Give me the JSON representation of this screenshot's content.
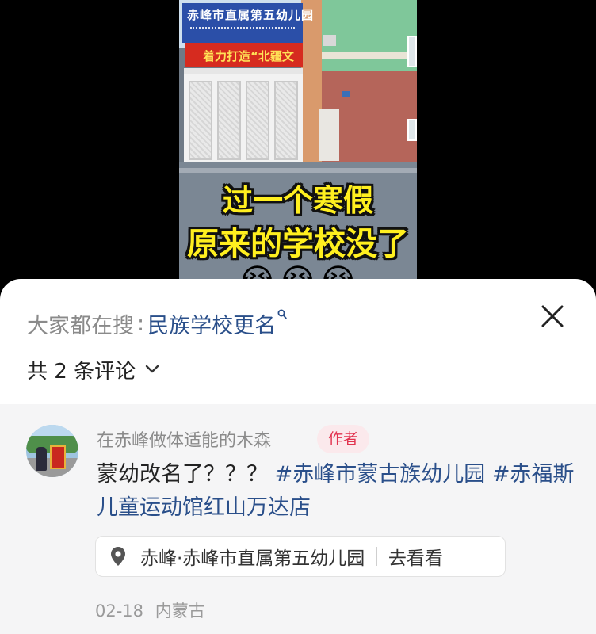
{
  "video": {
    "caption_line1": "过一个寒假",
    "caption_line2": "原来的学校没了",
    "caption_emoji": "😭😭😭",
    "sign_blue_text": "赤峰市直属第五幼儿园",
    "sign_red_text": "着力打造“北疆文"
  },
  "sheet": {
    "search": {
      "prefix": "大家都在搜",
      "separator": ":",
      "term": "民族学校更名",
      "icon": "search-icon"
    },
    "close_icon": "close-icon",
    "comment_count": "共 2 条评论",
    "count_icon": "chevron-down-icon"
  },
  "comment": {
    "username": "在赤峰做体适能的木森",
    "badge": "作者",
    "text": "蒙幼改名了？？？",
    "hashtag1": "#赤峰市蒙古族幼儿园",
    "hashtag2": "#赤福斯儿童运动馆红山万达店",
    "location": {
      "icon": "location-pin-icon",
      "name": "赤峰·赤峰市直属第五幼儿园",
      "action": "去看看"
    },
    "date": "02-18",
    "region": "内蒙古"
  },
  "colors": {
    "link": "#2a4f8a",
    "badge_bg": "#fbe9ec",
    "badge_text": "#e2334f",
    "comment_bg": "#f5f5f6"
  }
}
